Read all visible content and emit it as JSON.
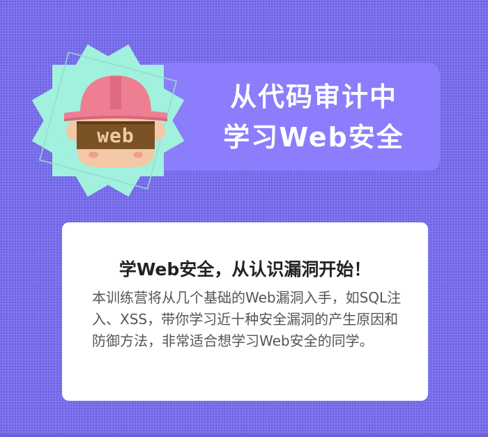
{
  "header": {
    "title_line1": "从代码审计中",
    "title_line2": "学习Web安全"
  },
  "mascot": {
    "icon": "web-mascot-icon",
    "text": "web"
  },
  "card": {
    "title": "学Web安全，从认识漏洞开始！",
    "body": "本训练营将从几个基础的Web漏洞入手，如SQL注入、XSS，带你学习近十种安全漏洞的产生原因和防御方法，非常适合想学习Web安全的同学。"
  },
  "colors": {
    "background": "#7f74ef",
    "title_panel": "#8b7dfb",
    "badge_mint": "#a2f0de",
    "helmet": "#ee7e92",
    "skin": "#f3c8a6",
    "hair": "#7b5126",
    "card": "#ffffff"
  }
}
